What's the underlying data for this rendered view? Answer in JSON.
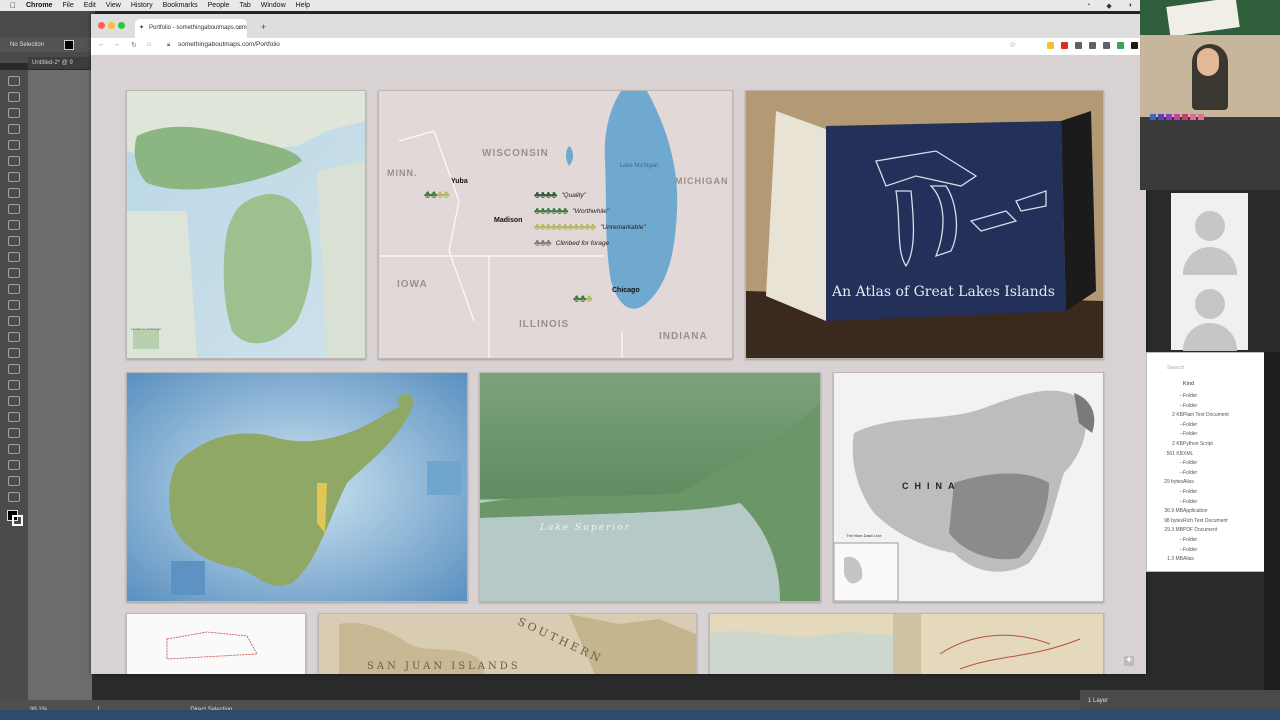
{
  "menubar": {
    "apple": "",
    "items": [
      "Chrome",
      "File",
      "Edit",
      "View",
      "History",
      "Bookmarks",
      "People",
      "Tab",
      "Window",
      "Help"
    ]
  },
  "illustrator": {
    "selection_label": "No Selection",
    "doc_tab": "Untitled-2* @ 9",
    "zoom": "99.1%",
    "artboard": "1",
    "tool_name": "Direct Selection",
    "layers_label": "1 Layer"
  },
  "browser": {
    "tab_title": "Portfolio - somethingaboutmaps.com",
    "url": "somethingaboutmaps.com/Portfolio",
    "close_glyph": "×",
    "newtab_glyph": "+",
    "back_glyph": "←",
    "forward_glyph": "→",
    "reload_glyph": "↻",
    "home_glyph": "⌂",
    "extension_colors": [
      "#f2c12e",
      "#d93025",
      "#5f6368",
      "#5f6368",
      "#5f6368",
      "#34a853",
      "#1a1a1a"
    ]
  },
  "maps": {
    "michigan": {
      "legend": "Landforms of Michigan"
    },
    "midwest": {
      "states": [
        "WISCONSIN",
        "MICHIGAN",
        "MINN.",
        "IOWA",
        "ILLINOIS",
        "INDIANA"
      ],
      "lake_label": "Lake Michigan",
      "cities": [
        "Yuba",
        "Madison",
        "Chicago"
      ],
      "legend": [
        "\"Quality\"",
        "\"Worthwhile\"",
        "\"Unremarkable\"",
        "Climbed for forage"
      ]
    },
    "atlas": {
      "title": "An Atlas of Great Lakes Islands"
    },
    "lake_superior": {
      "label": "Lake Superior"
    },
    "china": {
      "label": "CHINA",
      "inset": "The Nine-Dash Line"
    },
    "san_juan": {
      "label": "SAN JUAN ISLANDS",
      "curve": "SOUTHERN"
    }
  },
  "finder": {
    "search_placeholder": "Search",
    "kind_header": "Kind",
    "rows": [
      {
        "size": "--",
        "kind": "Folder"
      },
      {
        "size": "--",
        "kind": "Folder"
      },
      {
        "size": "2 KB",
        "kind": "Plain Text Document"
      },
      {
        "size": "--",
        "kind": "Folder"
      },
      {
        "size": "--",
        "kind": "Folder"
      },
      {
        "size": "2 KB",
        "kind": "Python Script"
      },
      {
        "size": "561 KB",
        "kind": "XML"
      },
      {
        "size": "--",
        "kind": "Folder"
      },
      {
        "size": "--",
        "kind": "Folder"
      },
      {
        "size": "29 bytes",
        "kind": "Alias"
      },
      {
        "size": "--",
        "kind": "Folder"
      },
      {
        "size": "--",
        "kind": "Folder"
      },
      {
        "size": "36.9 MB",
        "kind": "Application"
      },
      {
        "size": "98 bytes",
        "kind": "Rich Text Document"
      },
      {
        "size": "29.3 MB",
        "kind": "PDF Document"
      },
      {
        "size": "--",
        "kind": "Folder"
      },
      {
        "size": "--",
        "kind": "Folder"
      },
      {
        "size": "1.3 MB",
        "kind": "Alias"
      }
    ]
  }
}
